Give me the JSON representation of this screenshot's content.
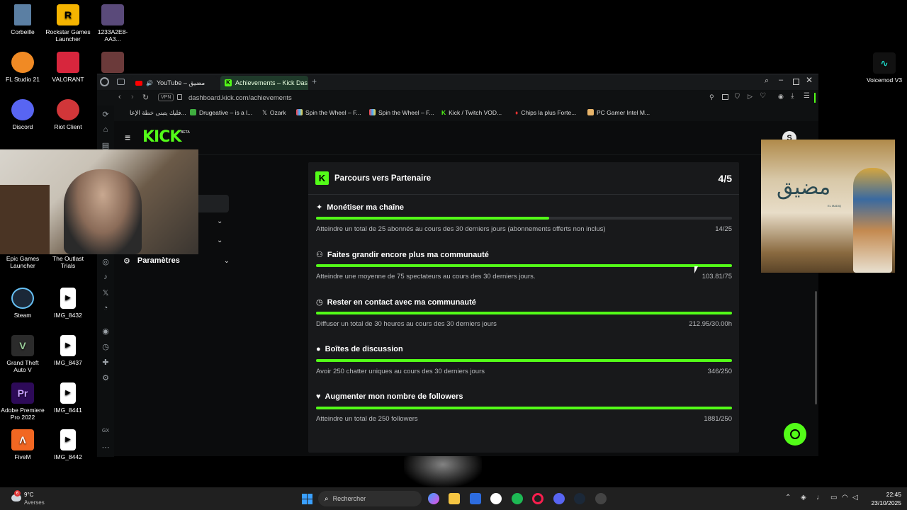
{
  "desktop": {
    "icons": [
      {
        "label": "Corbeille",
        "color": "#8ab4d8"
      },
      {
        "label": "Rockstar Games Launcher",
        "color": "#f5b400",
        "glyph": "R"
      },
      {
        "label": "1233A2E8-AA3...",
        "color": "#5a4a7a"
      },
      {
        "label": "FL Studio 21",
        "color": "#f08a24"
      },
      {
        "label": "VALORANT",
        "color": "#d7263d"
      },
      {
        "label": "Discord",
        "color": "#5865f2"
      },
      {
        "label": "Riot Client",
        "color": "#d13639"
      },
      {
        "label": "Epic Games Launcher",
        "color": "#333333"
      },
      {
        "label": "The Outlast Trials",
        "color": "#444444"
      },
      {
        "label": "Steam",
        "color": "#1b2838"
      },
      {
        "label": "IMG_8432",
        "color": "#ffffff"
      },
      {
        "label": "Grand Theft Auto V",
        "color": "#2b2b2b"
      },
      {
        "label": "IMG_8437",
        "color": "#ffffff"
      },
      {
        "label": "Adobe Premiere Pro 2022",
        "color": "#2d0a58",
        "glyph": "Pr"
      },
      {
        "label": "IMG_8441",
        "color": "#ffffff"
      },
      {
        "label": "FiveM",
        "color": "#f26722"
      },
      {
        "label": "IMG_8442",
        "color": "#ffffff"
      },
      {
        "label": "Voicemod V3",
        "color": "#1fd1c1"
      }
    ]
  },
  "browser": {
    "tabs": [
      {
        "label": "YouTube – مضيق"
      },
      {
        "label": "Achievements – Kick Das"
      }
    ],
    "url": "dashboard.kick.com/achievements",
    "vpn_label": "VPN",
    "bookmarks": [
      "فليك يتبنى خطة الإعا...",
      "Drugeative – is a l...",
      "Ozark",
      "Spin the Wheel – F...",
      "Spin the Wheel – F...",
      "Kick / Twitch VOD...",
      "Chips la plus Forte...",
      "PC Gamer Intel M..."
    ],
    "gx_label": "GX"
  },
  "kick": {
    "logo": "KICK",
    "beta": "BETA",
    "sidebar_settings": "Paramètres",
    "panel_title": "Parcours vers Partenaire",
    "panel_progress": "4/5",
    "accent": "#53fc18",
    "achievements": [
      {
        "icon": "sparkle-icon",
        "title": "Monétiser ma chaîne",
        "desc": "Atteindre un total de 25 abonnés au cours des 30 derniers jours (abonnements offerts non inclus)",
        "count": "14/25",
        "progress": 0.56
      },
      {
        "icon": "people-icon",
        "title": "Faites grandir encore plus ma communauté",
        "desc": "Atteindre une moyenne de 75 spectateurs au cours des 30 derniers jours.",
        "count": "103.81/75",
        "progress": 1
      },
      {
        "icon": "clock-icon",
        "title": "Rester en contact avec ma communauté",
        "desc": "Diffuser un total de 30 heures au cours des 30 derniers jours",
        "count": "212.95/30.00h",
        "progress": 1
      },
      {
        "icon": "chat-icon",
        "title": "Boîtes de discussion",
        "desc": "Avoir 250 chatter uniques au cours des 30 derniers jours",
        "count": "346/250",
        "progress": 1
      },
      {
        "icon": "heart-icon",
        "title": "Augmenter mon nombre de followers",
        "desc": "Atteindre un total de 250 followers",
        "count": "1881/250",
        "progress": 1
      }
    ]
  },
  "overlay_image": {
    "caption_ar": "مضيق",
    "caption_small": "EL MADIQ"
  },
  "taskbar": {
    "weather_temp": "9°C",
    "weather_desc": "Averses",
    "weather_badge": "6",
    "search_placeholder": "Rechercher",
    "time": "22:45",
    "date": "23/10/2025"
  }
}
